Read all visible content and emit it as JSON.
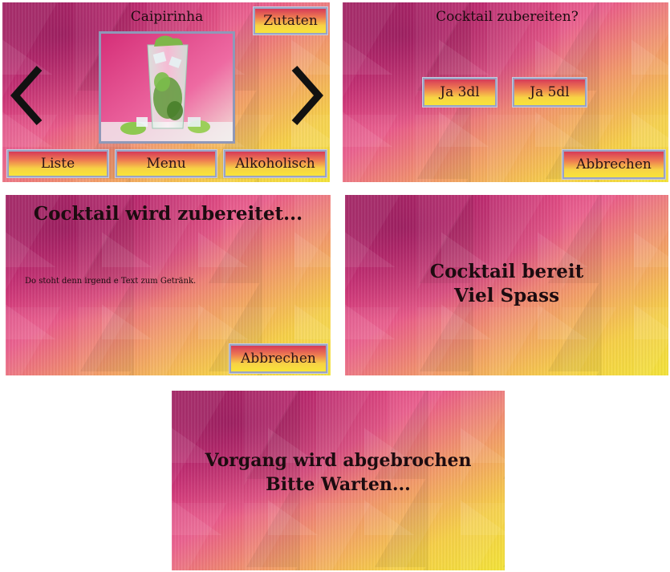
{
  "screen1": {
    "title": "Caipirinha",
    "ingredients_button": "Zutaten",
    "prev_icon": "chevron-left-icon",
    "next_icon": "chevron-right-icon",
    "list_button": "Liste",
    "menu_button": "Menu",
    "alcoholic_button": "Alkoholisch"
  },
  "screen2": {
    "question": "Cocktail zubereiten?",
    "option_3dl": "Ja 3dl",
    "option_5dl": "Ja 5dl",
    "cancel_button": "Abbrechen"
  },
  "screen3": {
    "heading": "Cocktail wird zubereitet...",
    "description": "Do stoht denn irgend e Text zum Getränk.",
    "cancel_button": "Abbrechen"
  },
  "screen4": {
    "line1": "Cocktail bereit",
    "line2": "Viel Spass"
  },
  "screen5": {
    "line1": "Vorgang wird abgebrochen",
    "line2": "Bitte Warten..."
  },
  "colors": {
    "gradient_pink": "#d4327a",
    "gradient_yellow": "#f4e43a",
    "button_border": "#9aa3c4",
    "text": "#1c0c10"
  }
}
